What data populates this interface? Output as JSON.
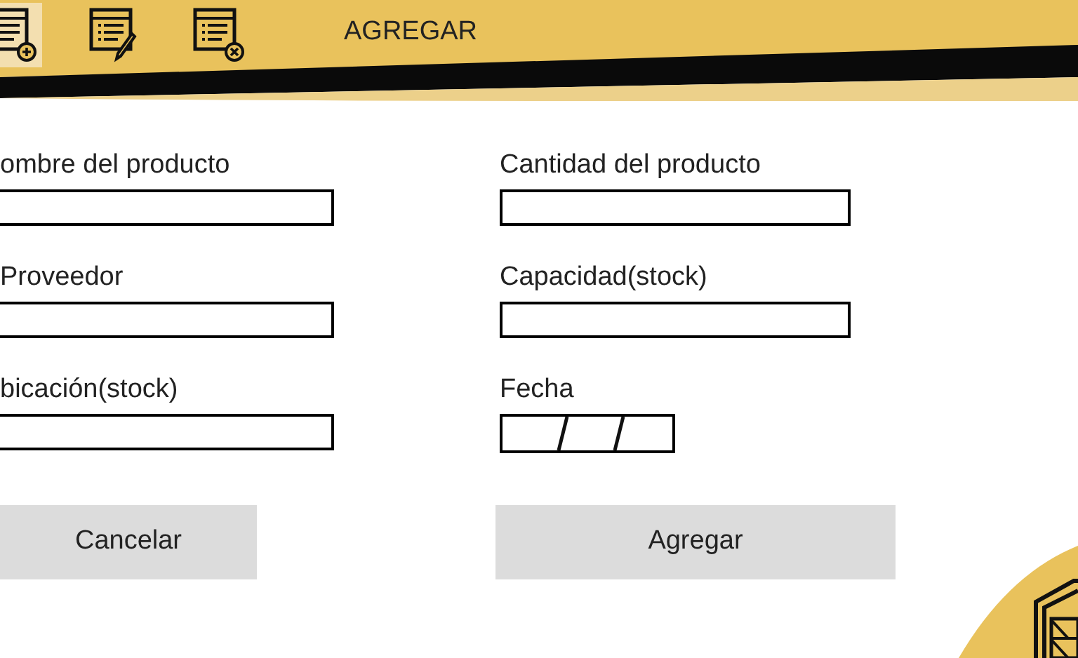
{
  "toolbar": {
    "tools": [
      {
        "kind": "add",
        "selected": true
      },
      {
        "kind": "edit",
        "selected": false
      },
      {
        "kind": "delete",
        "selected": false
      }
    ],
    "title": "AGREGAR"
  },
  "form": {
    "left": [
      {
        "label": "ombre del producto",
        "kind": "text"
      },
      {
        "label": "Proveedor",
        "kind": "text"
      },
      {
        "label": "bicación(stock)",
        "kind": "text"
      }
    ],
    "right": [
      {
        "label": "Cantidad del producto",
        "kind": "text"
      },
      {
        "label": "Capacidad(stock)",
        "kind": "text"
      },
      {
        "label": "Fecha",
        "kind": "date"
      }
    ]
  },
  "buttons": {
    "cancel": "Cancelar",
    "submit": "Agregar"
  }
}
